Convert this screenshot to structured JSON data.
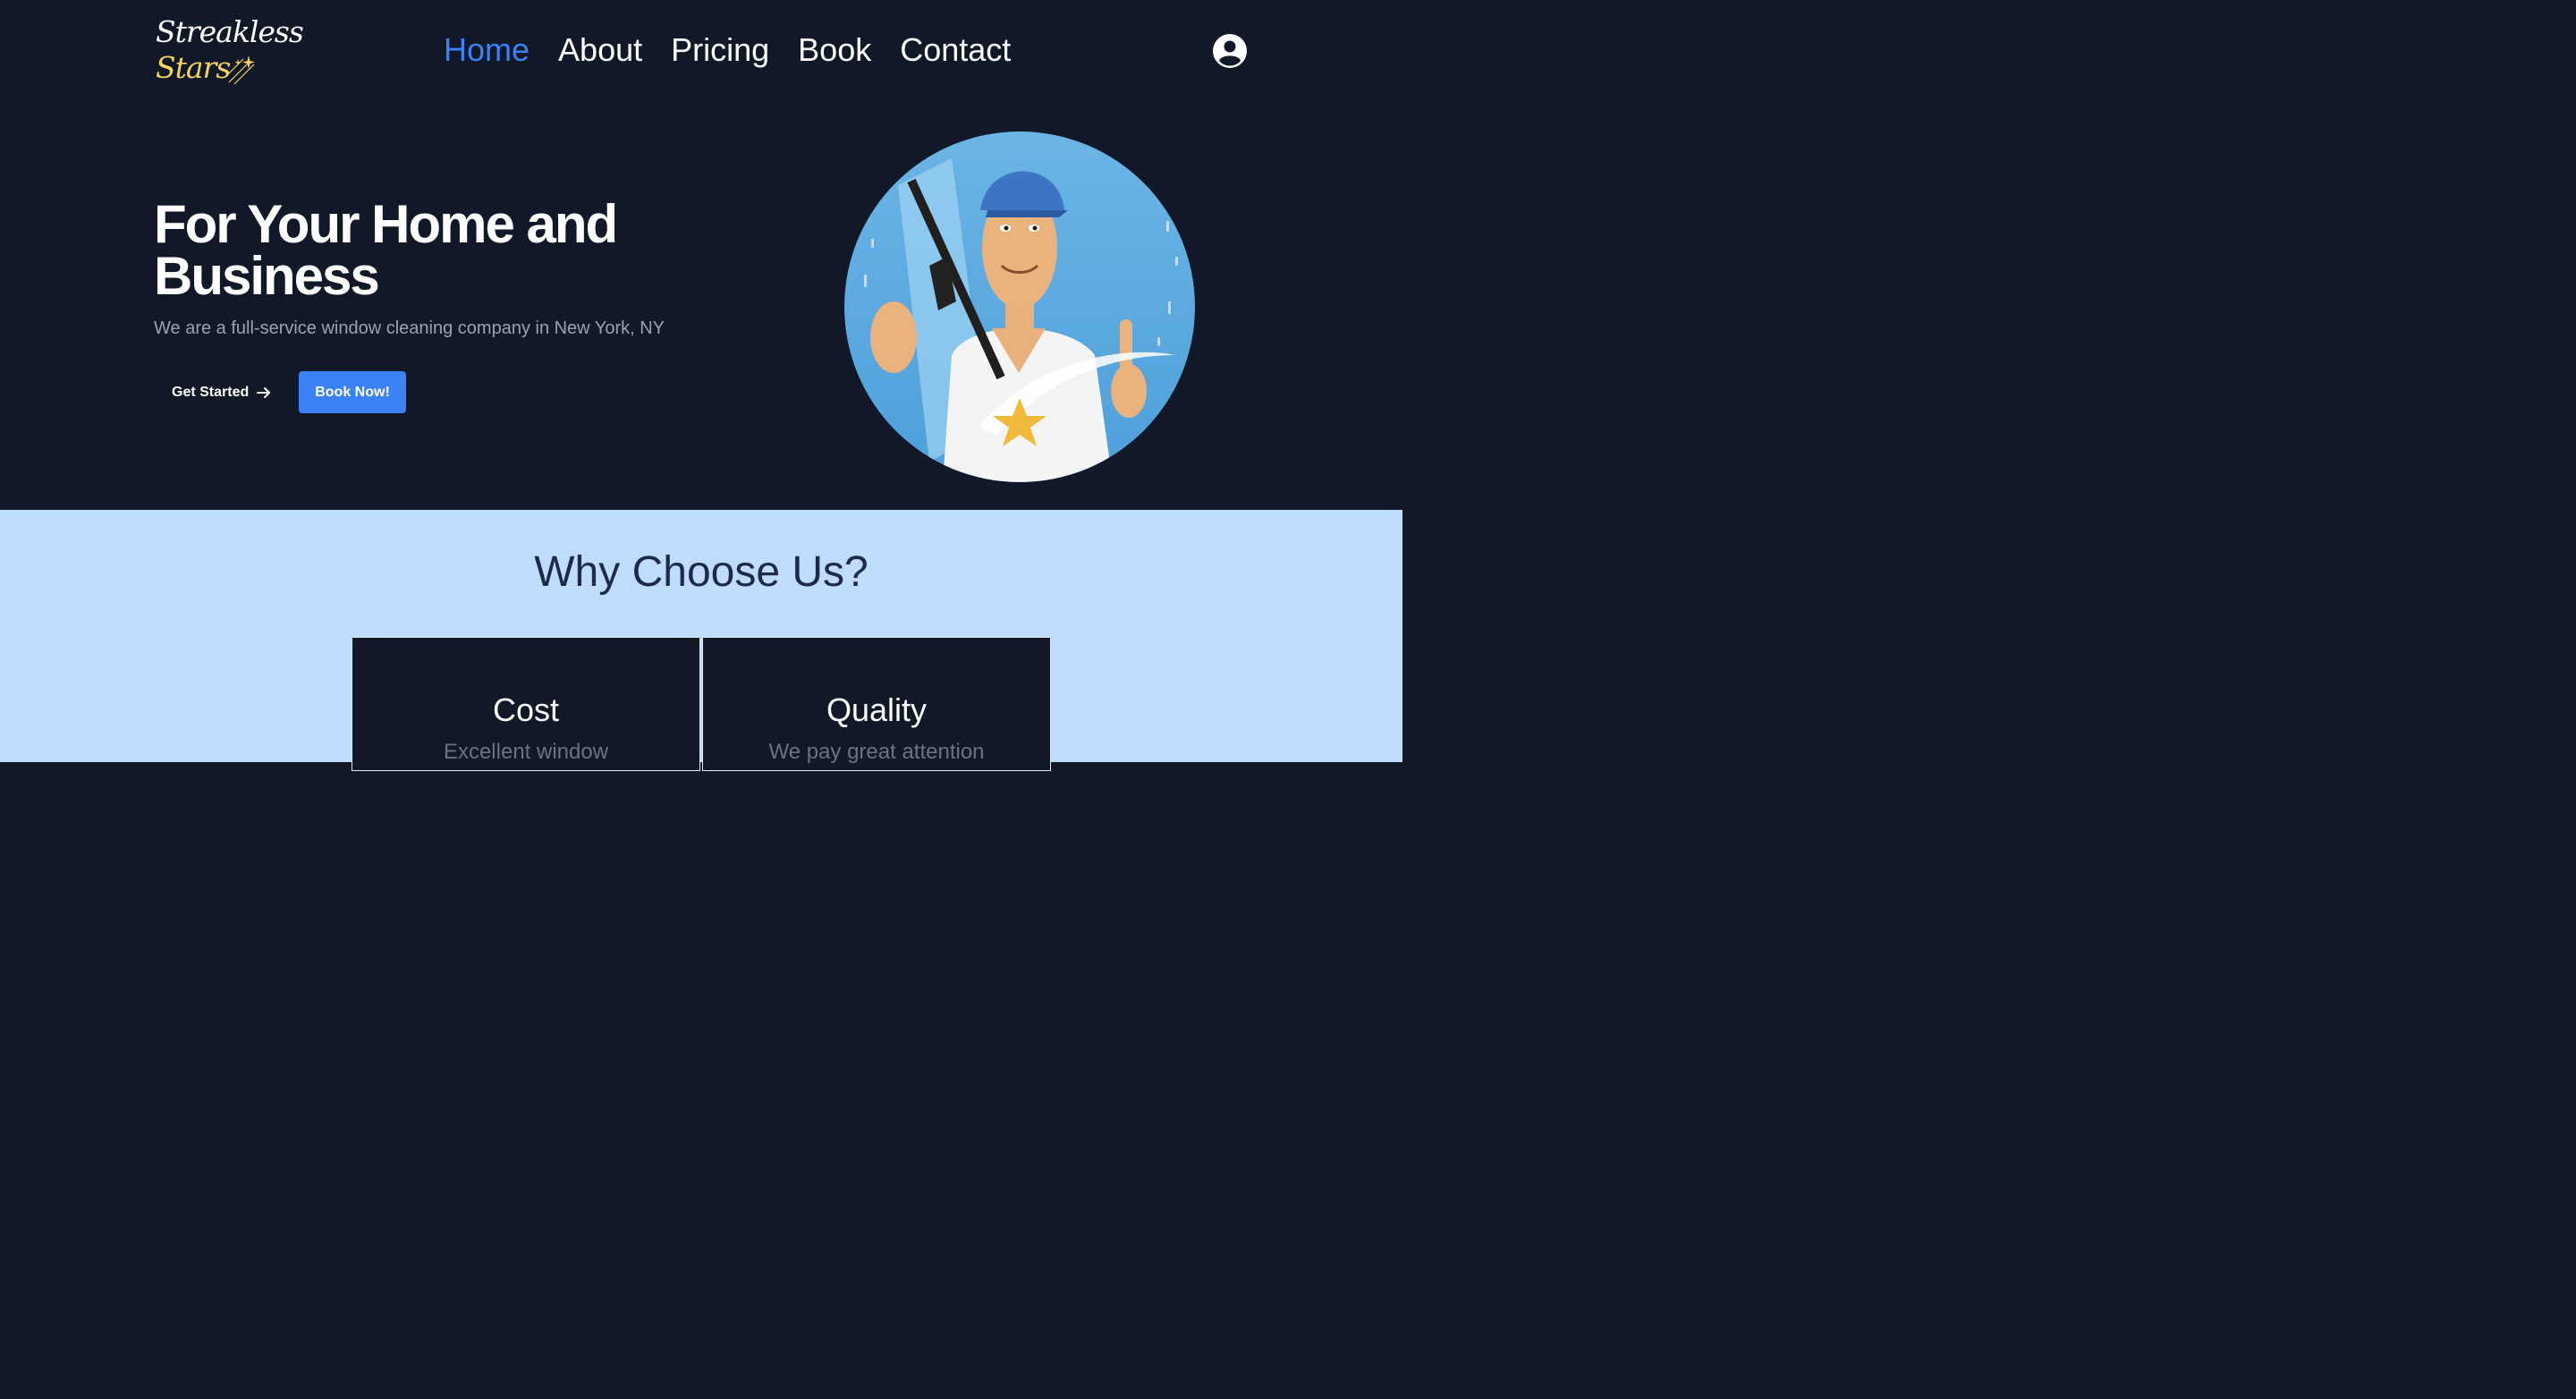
{
  "brand": {
    "logo_line1": "Streakless",
    "logo_line2": "Stars",
    "logo_text_color": "#ffffff",
    "logo_accent_color": "#f4d35e"
  },
  "nav": {
    "items": [
      {
        "label": "Home",
        "active": true
      },
      {
        "label": "About",
        "active": false
      },
      {
        "label": "Pricing",
        "active": false
      },
      {
        "label": "Book",
        "active": false
      },
      {
        "label": "Contact",
        "active": false
      }
    ],
    "account_icon": "user-circle-icon"
  },
  "hero": {
    "title": "For Your Home and Business",
    "subtitle": "We are a full-service window cleaning company in New York, NY",
    "get_started_label": "Get Started",
    "get_started_icon": "arrow-right-icon",
    "book_label": "Book Now!",
    "image_subject": "window-cleaner-illustration"
  },
  "why": {
    "title": "Why Choose Us?",
    "cards": [
      {
        "title": "Cost",
        "text": "Excellent window"
      },
      {
        "title": "Quality",
        "text": "We pay great attention"
      }
    ]
  },
  "colors": {
    "background_dark": "#111827",
    "accent_blue": "#3b82f6",
    "section_light": "#bfdbfe",
    "heading_dark": "#1e2a4a"
  }
}
